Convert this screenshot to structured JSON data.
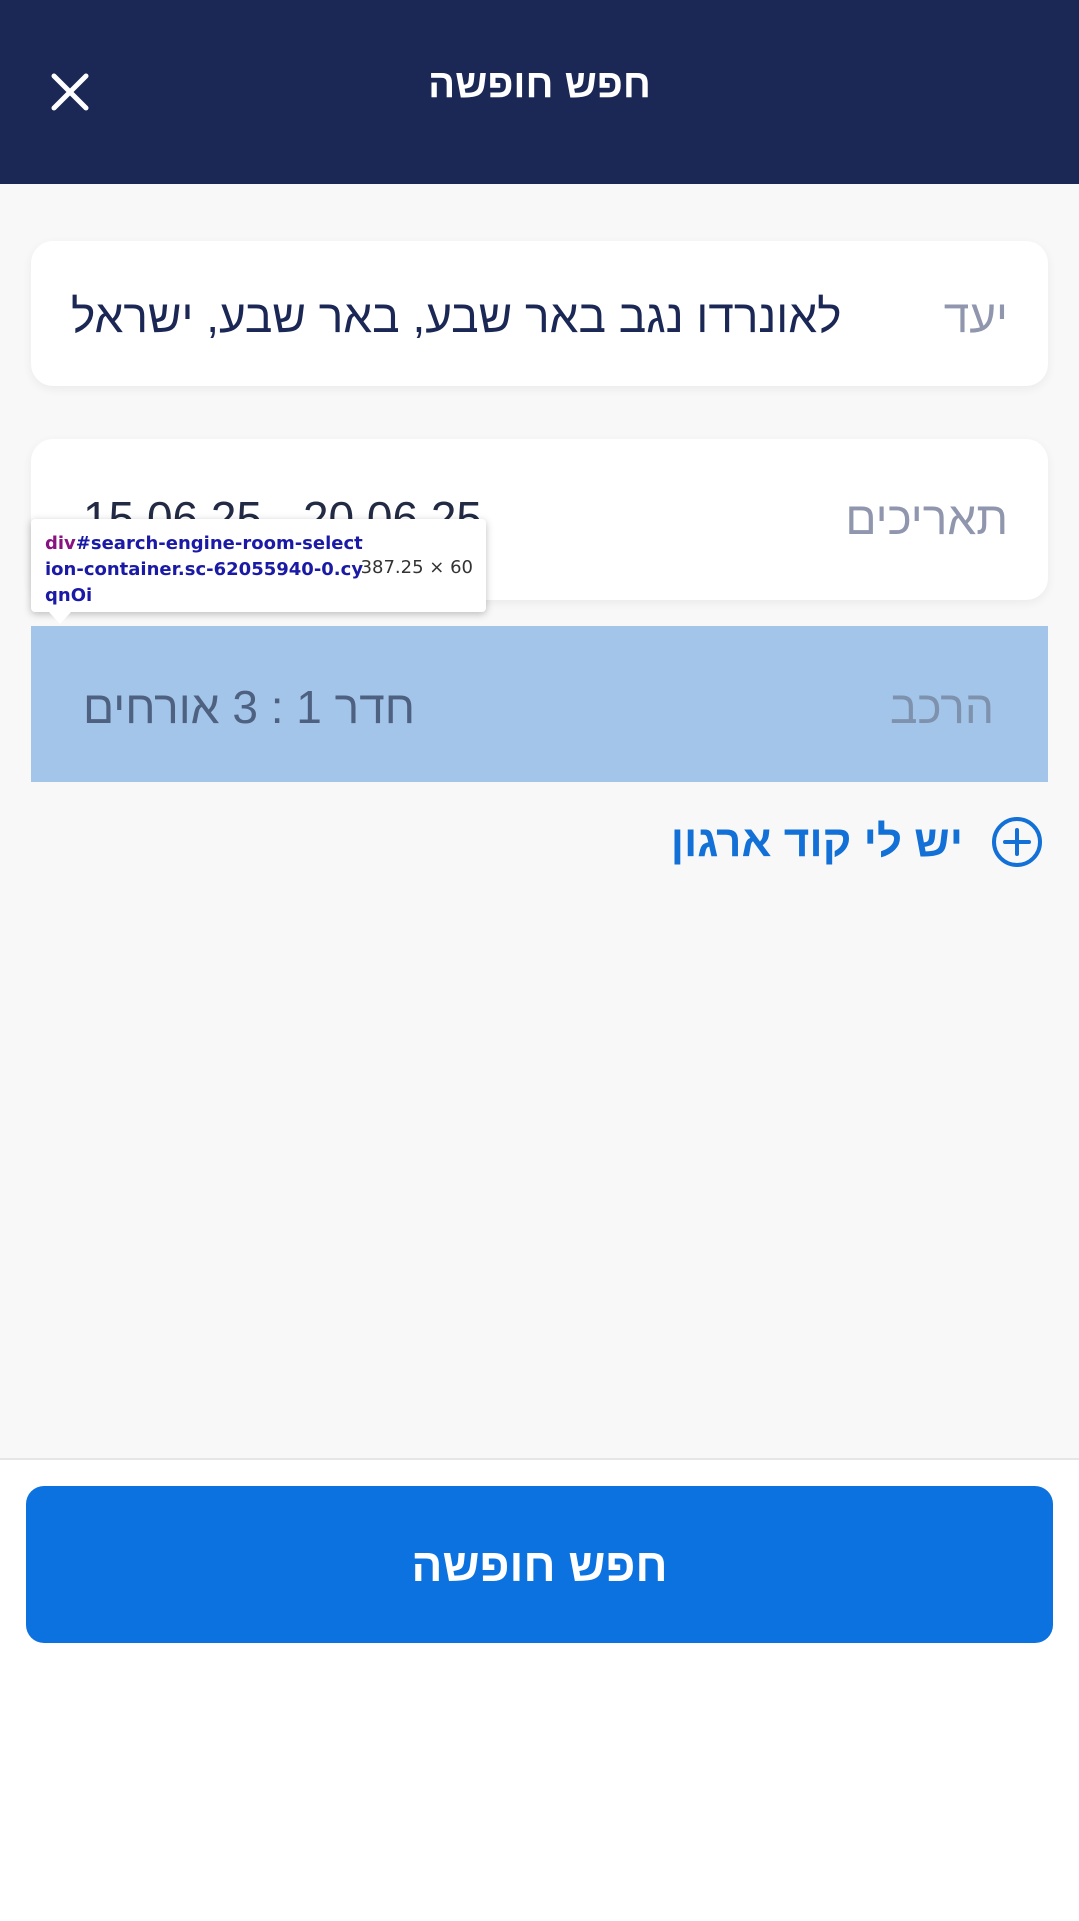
{
  "header": {
    "title": "חפש חופשה",
    "close_icon": "close-icon"
  },
  "destination": {
    "label": "יעד",
    "value": "לאונרדו נגב באר שבע, באר שבע, ישראל"
  },
  "dates": {
    "label": "תאריכים",
    "value": "15.06.25 - 20.06.25"
  },
  "composition": {
    "label": "הרכב",
    "value": "חדר 1 : 3 אורחים"
  },
  "org_code": {
    "label": "יש לי קוד ארגון",
    "icon": "plus-circle-icon"
  },
  "search_button": {
    "label": "חפש חופשה"
  },
  "devtools_tooltip": {
    "tag": "div",
    "selector": "#search-engine-room-selection-container.sc-62055940-0.cyqnOi",
    "size": "387.25 × 60"
  },
  "colors": {
    "header_bg": "#1b2754",
    "accent": "#0b72df",
    "highlight": "#a3c5e9"
  }
}
